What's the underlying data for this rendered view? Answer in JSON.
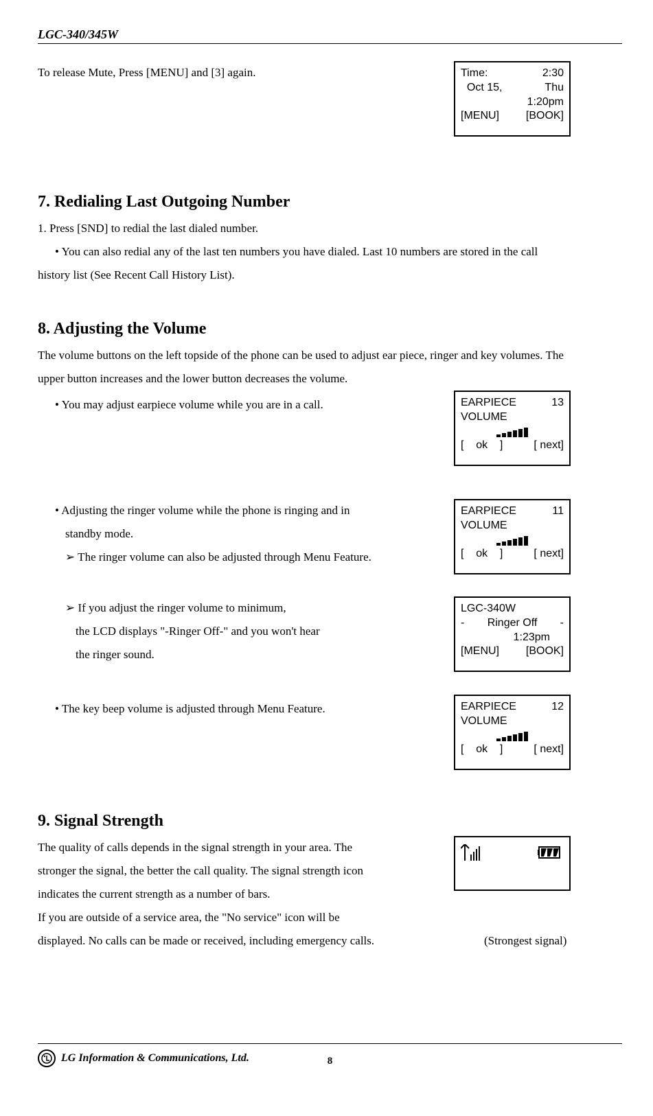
{
  "header": {
    "model": "LGC-340/345W"
  },
  "intro_line": "To release Mute, Press [MENU] and [3] again.",
  "box_time": {
    "row1_left": "Time:",
    "row1_right": "2:30",
    "row2_left": "  Oct 15,",
    "row2_right": "Thu",
    "row3": "1:20pm",
    "row4_left": "[MENU]",
    "row4_right": "[BOOK]"
  },
  "sec7": {
    "title": "7. Redialing Last Outgoing Number",
    "line1": "1. Press [SND] to redial the last dialed number.",
    "bullet": "• You can also redial any of the last ten numbers you have dialed. Last 10 numbers are stored in the call",
    "line3": "history list (See Recent Call History List)."
  },
  "sec8": {
    "title": "8. Adjusting the Volume",
    "para1": "The volume buttons on the left topside of the phone can be used to adjust ear piece, ringer and key volumes. The",
    "para1b": "upper button increases and the lower button decreases the volume.",
    "b1": "• You may adjust earpiece volume while you are in a call.",
    "b2a": "• Adjusting the ringer volume while the phone is ringing and in",
    "b2b": "standby mode.",
    "b2c": "➢ The ringer volume can also be adjusted through Menu Feature.",
    "b3a": "➢ If you adjust the ringer volume to minimum,",
    "b3b": "the LCD displays \"-Ringer Off-\" and you won't hear",
    "b3c": "the ringer sound.",
    "b4": "• The key beep volume is adjusted through Menu Feature."
  },
  "box_ep13": {
    "l1_left": "EARPIECE",
    "l1_right": "13",
    "l2": "VOLUME",
    "l3_left": "[    ok    ]",
    "l3_right": "[ next]"
  },
  "box_ep11": {
    "l1_left": "EARPIECE",
    "l1_right": "11",
    "l2": "VOLUME",
    "l3_left": "[    ok    ]",
    "l3_right": "[ next]"
  },
  "box_ringer": {
    "l1": "LGC-340W",
    "l2_dash": "-",
    "l2_mid": "Ringer Off",
    "l2_dash2": "-",
    "l3": "1:23pm",
    "l4_left": "[MENU]",
    "l4_right": "[BOOK]"
  },
  "box_ep12": {
    "l1_left": "EARPIECE",
    "l1_right": "12",
    "l2": "VOLUME",
    "l3_left": "[    ok    ]",
    "l3_right": "[ next]"
  },
  "sec9": {
    "title": "9. Signal Strength",
    "p1": "The quality of calls depends in the signal strength in your area. The",
    "p2": "stronger the signal, the better the call quality. The signal strength icon",
    "p3": "indicates the current strength as a number of bars.",
    "p4": "If you are outside of a service area, the \"No service\" icon will be",
    "p5a": "displayed. No calls can be made or received, including emergency calls.",
    "p5b": "(Strongest signal)"
  },
  "footer": {
    "company": "LG Information & Communications, Ltd.",
    "page": "8",
    "logo_letter": "L"
  }
}
